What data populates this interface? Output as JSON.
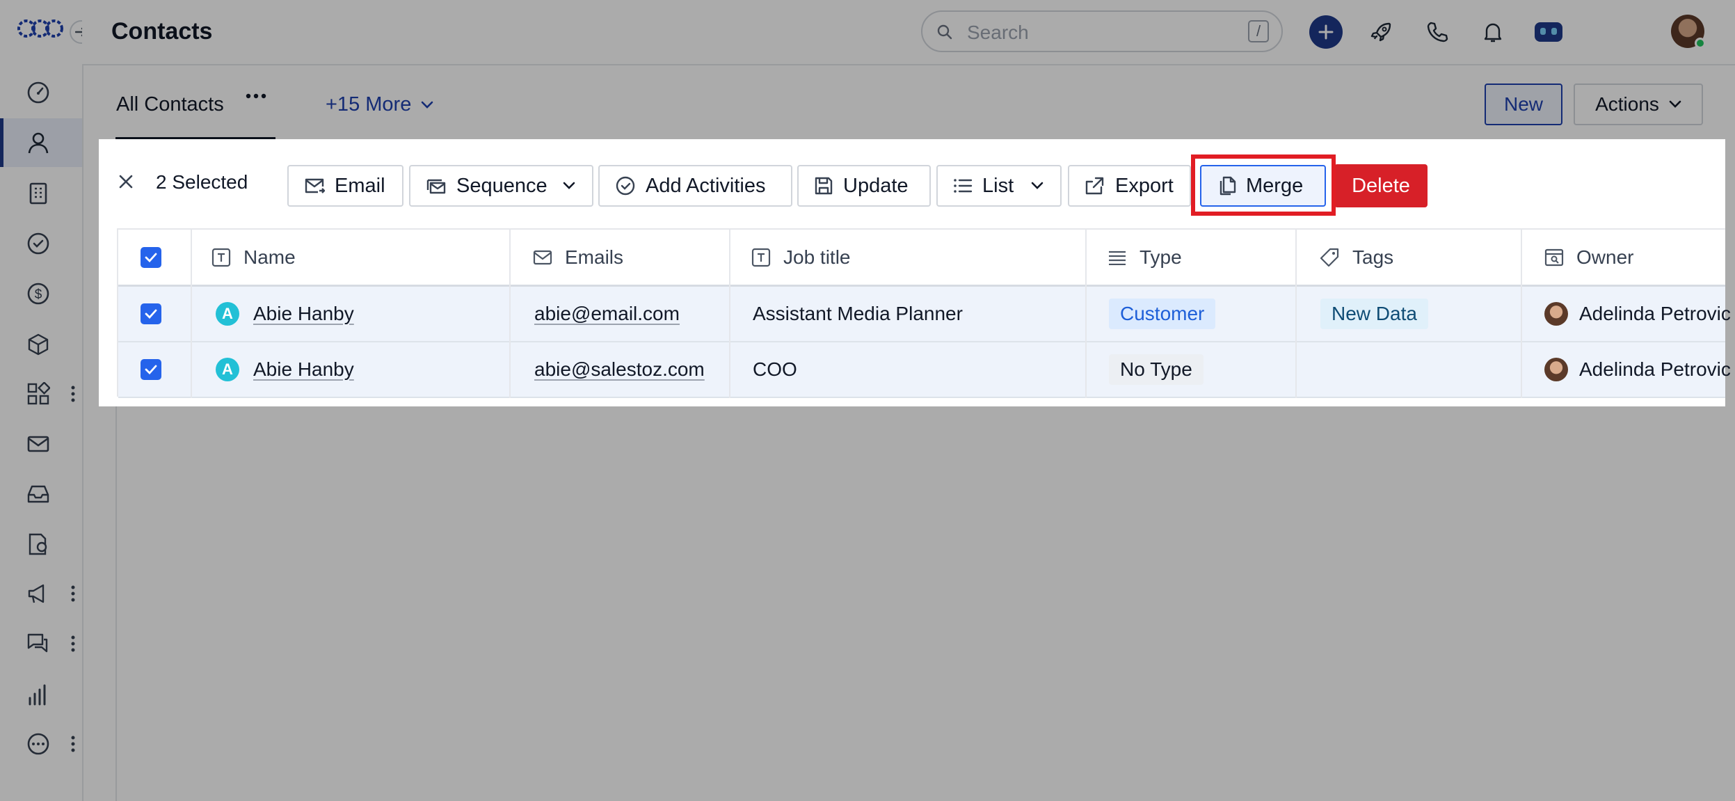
{
  "app": {
    "title": "Contacts"
  },
  "sidebar": {
    "items": [
      {
        "icon": "dashboard-icon"
      },
      {
        "icon": "contacts-icon",
        "active": true
      },
      {
        "icon": "companies-icon"
      },
      {
        "icon": "tasks-icon"
      },
      {
        "icon": "deals-icon"
      },
      {
        "icon": "products-icon"
      },
      {
        "icon": "apps-icon"
      },
      {
        "icon": "email-icon"
      },
      {
        "icon": "inbox-icon"
      },
      {
        "icon": "documents-icon"
      },
      {
        "icon": "campaigns-icon"
      },
      {
        "icon": "conversations-icon"
      },
      {
        "icon": "reports-icon"
      },
      {
        "icon": "more-icon"
      }
    ]
  },
  "search": {
    "placeholder": "Search",
    "shortcut": "/"
  },
  "tabs": {
    "current": "All Contacts",
    "more": "+15 More"
  },
  "header_buttons": {
    "new": "New",
    "actions": "Actions"
  },
  "bulk": {
    "selected": "2 Selected",
    "email": "Email",
    "sequence": "Sequence",
    "add_activities": "Add Activities",
    "update": "Update",
    "list": "List",
    "export": "Export",
    "merge": "Merge",
    "delete": "Delete"
  },
  "table": {
    "columns": [
      "Name",
      "Emails",
      "Job title",
      "Type",
      "Tags",
      "Owner"
    ],
    "rows": [
      {
        "initial": "A",
        "name": "Abie Hanby",
        "email": "abie@email.com",
        "job": "Assistant Media Planner",
        "type": "Customer",
        "tag": "New Data",
        "owner": "Adelinda Petrovic"
      },
      {
        "initial": "A",
        "name": "Abie Hanby",
        "email": "abie@salestoz.com",
        "job": "COO",
        "type": "No Type",
        "tag": "",
        "owner": "Adelinda Petrovic"
      }
    ]
  },
  "colors": {
    "accent": "#1e3a8a",
    "delete": "#d72028",
    "highlight": "#e11d24",
    "checkbox": "#2563eb"
  }
}
